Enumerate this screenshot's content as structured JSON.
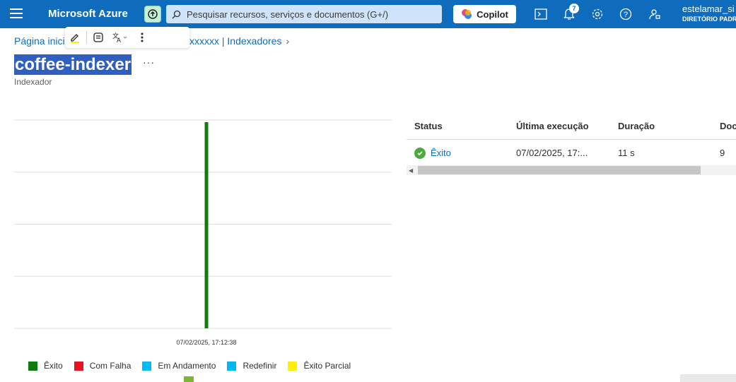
{
  "topbar": {
    "brand": "Microsoft Azure",
    "search_placeholder": "Pesquisar recursos, serviços e documentos (G+/)",
    "copilot_label": "Copilot",
    "notifications_count": "7",
    "user_name": "estelamar_si",
    "directory": "DIRETÓRIO PADR"
  },
  "breadcrumb": {
    "home": "Página inicia",
    "resource": "xxxxxx | Indexadores",
    "chevron": "›"
  },
  "page": {
    "title": "coffee-indexer",
    "more": "···",
    "subtitle": "Indexador"
  },
  "chart_data": {
    "type": "bar",
    "categories": [
      "07/02/2025, 17:12:38"
    ],
    "series": [
      {
        "name": "Êxito",
        "values": [
          1
        ]
      }
    ],
    "ylim": [
      0,
      1
    ],
    "grid": true,
    "legend_position": "bottom",
    "legend": [
      {
        "label": "Êxito",
        "color": "#107c10"
      },
      {
        "label": "Com Falha",
        "color": "#e81123"
      },
      {
        "label": "Em Andamento",
        "color": "#00bcf2"
      },
      {
        "label": "Redefinir",
        "color": "#00b7ef"
      },
      {
        "label": "Êxito Parcial",
        "color": "#fff100"
      }
    ]
  },
  "table": {
    "headers": [
      "Status",
      "Última execução",
      "Duração",
      "Doc"
    ],
    "rows": [
      {
        "status": "Êxito",
        "last_run": "07/02/2025, 17:...",
        "duration": "11 s",
        "docs": "9"
      }
    ]
  },
  "colors": {
    "topbar": "#0f6cbd",
    "link": "#0f6cbd",
    "success": "#107c10"
  }
}
